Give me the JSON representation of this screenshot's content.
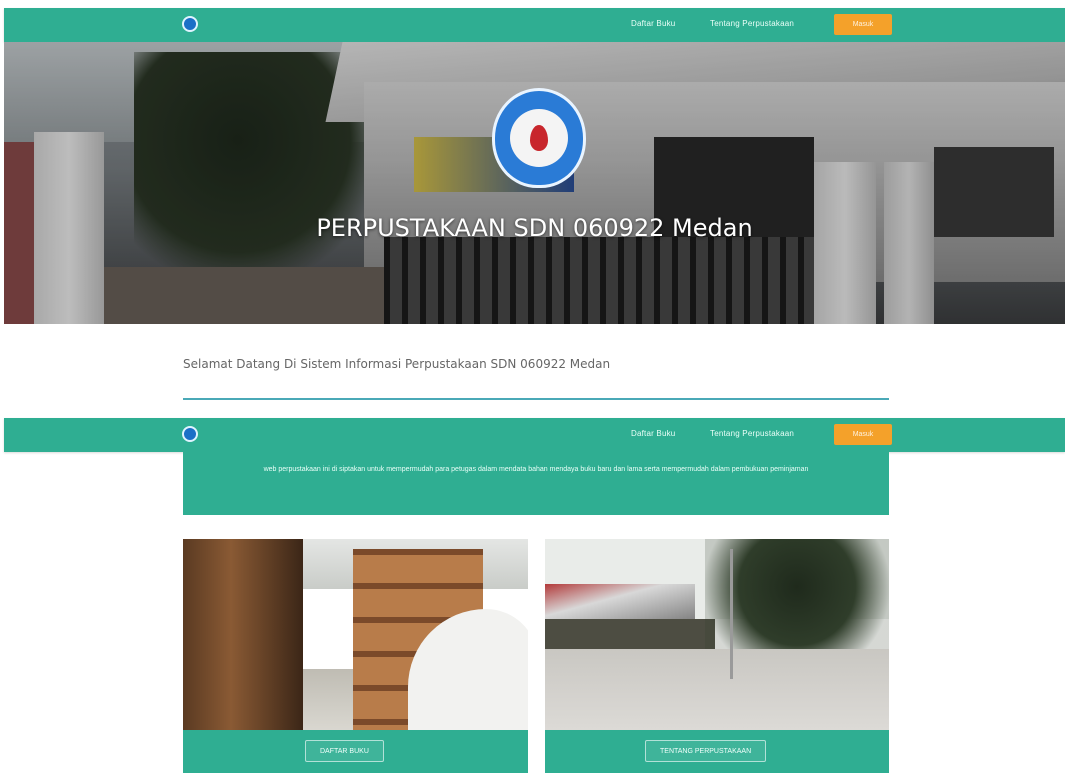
{
  "nav": {
    "links": [
      "Daftar Buku",
      "Tentang Perpustakaan"
    ],
    "button": "Masuk"
  },
  "hero": {
    "title": "PERPUSTAKAAN SDN 060922 Medan"
  },
  "welcome": {
    "text": "Selamat Datang Di Sistem Informasi Perpustakaan SDN 060922 Medan"
  },
  "info": {
    "text": "web perpustakaan ini di siptakan untuk mempermudah para petugas dalam mendata bahan mendaya buku baru dan lama serta mempermudah dalam pembukuan peminjaman"
  },
  "cards": [
    {
      "button": "DAFTAR BUKU"
    },
    {
      "button": "TENTANG PERPUSTAKAAN"
    }
  ],
  "colors": {
    "primary": "#2fae92",
    "accent": "#f4a12a",
    "divider": "#4aa9b7"
  }
}
